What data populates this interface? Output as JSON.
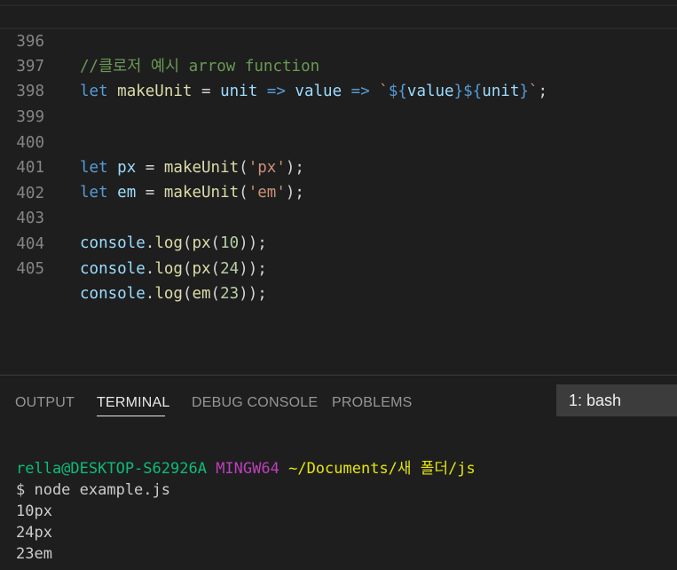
{
  "editor": {
    "lines": [
      {
        "num": "396",
        "comment": "//클로저 예시 arrow function"
      },
      {
        "num": "397",
        "kw": "let",
        "name": "makeUnit",
        "eq": "=",
        "p1": "unit",
        "arrow1": "=>",
        "p2": "value",
        "arrow2": "=>",
        "tpl_open": "`",
        "tpl_d1": "${",
        "tpl_v1": "value",
        "tpl_c1": "}",
        "tpl_d2": "${",
        "tpl_v2": "unit",
        "tpl_c2": "}",
        "tpl_close": "`",
        "semi": ";"
      },
      {
        "num": "398"
      },
      {
        "num": "399"
      },
      {
        "num": "400",
        "kw": "let",
        "name": "px",
        "eq": "=",
        "fn": "makeUnit",
        "open": "(",
        "str": "'px'",
        "close": ");"
      },
      {
        "num": "401",
        "kw": "let",
        "name": "em",
        "eq": "=",
        "fn": "makeUnit",
        "open": "(",
        "str": "'em'",
        "close": ");"
      },
      {
        "num": "402"
      },
      {
        "num": "403",
        "obj": "console",
        "dot": ".",
        "method": "log",
        "open": "(",
        "fn": "px",
        "open2": "(",
        "num_arg": "10",
        "close": "));"
      },
      {
        "num": "404",
        "obj": "console",
        "dot": ".",
        "method": "log",
        "open": "(",
        "fn": "px",
        "open2": "(",
        "num_arg": "24",
        "close": "));"
      },
      {
        "num": "405",
        "obj": "console",
        "dot": ".",
        "method": "log",
        "open": "(",
        "fn": "em",
        "open2": "(",
        "num_arg": "23",
        "close": "));"
      }
    ]
  },
  "panel": {
    "tabs": [
      "OUTPUT",
      "TERMINAL",
      "DEBUG CONSOLE",
      "PROBLEMS"
    ],
    "active_tab": "TERMINAL",
    "terminal_select": "1: bash"
  },
  "terminal": {
    "prompt_user": "rella@DESKTOP-S62926A",
    "prompt_env": "MINGW64",
    "prompt_path": "~/Documents/새 폴더/js",
    "command": "$ node example.js",
    "output": [
      "10px",
      "24px",
      "23em"
    ]
  }
}
